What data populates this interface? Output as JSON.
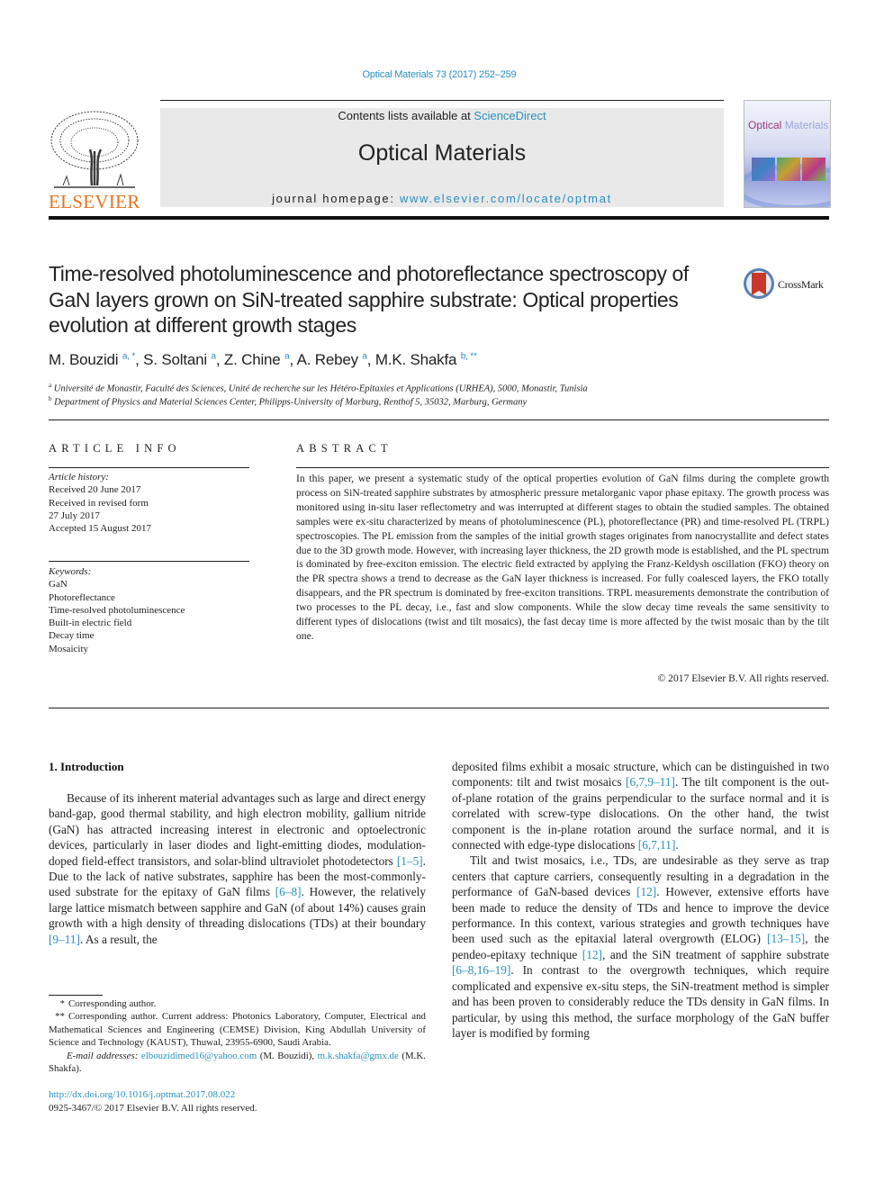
{
  "header": {
    "citation": "Optical Materials 73 (2017) 252–259",
    "publisher_wordmark": "ELSEVIER",
    "contents_prefix": "Contents lists available at ",
    "contents_link": "ScienceDirect",
    "journal_title": "Optical Materials",
    "homepage_prefix": "journal homepage: ",
    "homepage_link": "www.elsevier.com/locate/optmat",
    "cover": {
      "title_part1": "Optical ",
      "title_part2": "Materials"
    }
  },
  "article": {
    "title": "Time-resolved photoluminescence and photoreflectance spectroscopy of GaN layers grown on SiN-treated sapphire substrate: Optical properties evolution at different growth stages",
    "crossmark_label": "CrossMark",
    "authors": [
      {
        "name": "M. Bouzidi",
        "sup": "a, *",
        "sep": ", "
      },
      {
        "name": "S. Soltani",
        "sup": "a",
        "sep": ", "
      },
      {
        "name": "Z. Chine",
        "sup": "a",
        "sep": ", "
      },
      {
        "name": "A. Rebey",
        "sup": "a",
        "sep": ", "
      },
      {
        "name": "M.K. Shakfa",
        "sup": "b, **",
        "sep": ""
      }
    ],
    "affiliations": [
      {
        "mark": "a",
        "text": "Université de Monastir, Faculté des Sciences, Unité de recherche sur les Hétéro-Epitaxies et Applications (URHEA), 5000, Monastir, Tunisia"
      },
      {
        "mark": "b",
        "text": "Department of Physics and Material Sciences Center, Philipps-University of Marburg, Renthof 5, 35032, Marburg, Germany"
      }
    ]
  },
  "article_info": {
    "heading": "ARTICLE INFO",
    "history_label": "Article history:",
    "history": [
      "Received 20 June 2017",
      "Received in revised form",
      "27 July 2017",
      "Accepted 15 August 2017"
    ],
    "keywords_label": "Keywords:",
    "keywords": [
      "GaN",
      "Photoreflectance",
      "Time-resolved photoluminescence",
      "Built-in electric field",
      "Decay time",
      "Mosaicity"
    ]
  },
  "abstract": {
    "heading": "ABSTRACT",
    "text": "In this paper, we present a systematic study of the optical properties evolution of GaN films during the complete growth process on SiN-treated sapphire substrates by atmospheric pressure metalorganic vapor phase epitaxy. The growth process was monitored using in-situ laser reflectometry and was interrupted at different stages to obtain the studied samples. The obtained samples were ex-situ characterized by means of photoluminescence (PL), photoreflectance (PR) and time-resolved PL (TRPL) spectroscopies. The PL emission from the samples of the initial growth stages originates from nanocrystallite and defect states due to the 3D growth mode. However, with increasing layer thickness, the 2D growth mode is established, and the PL spectrum is dominated by free-exciton emission. The electric field extracted by applying the Franz-Keldysh oscillation (FKO) theory on the PR spectra shows a trend to decrease as the GaN layer thickness is increased. For fully coalesced layers, the FKO totally disappears, and the PR spectrum is dominated by free-exciton transitions. TRPL measurements demonstrate the contribution of two processes to the PL decay, i.e., fast and slow components. While the slow decay time reveals the same sensitivity to different types of dislocations (twist and tilt mosaics), the fast decay time is more affected by the twist mosaic than by the tilt one.",
    "copyright": "© 2017 Elsevier B.V. All rights reserved."
  },
  "body": {
    "section_heading": "1.  Introduction",
    "left_paragraph": [
      {
        "t": "Because of its inherent material advantages such as large and direct energy band-gap, good thermal stability, and high electron mobility, gallium nitride (GaN) has attracted increasing interest in electronic and optoelectronic devices, particularly in laser diodes and light-emitting diodes, modulation-doped field-effect transistors, and solar-blind ultraviolet photodetectors "
      },
      {
        "ref": "[1–5]"
      },
      {
        "t": ". Due to the lack of native substrates, sapphire has been the most-commonly-used substrate for the epitaxy of GaN films "
      },
      {
        "ref": "[6–8]"
      },
      {
        "t": ". However, the relatively large lattice mismatch between sapphire and GaN (of about 14%) causes grain growth with a high density of threading dislocations (TDs) at their boundary "
      },
      {
        "ref": "[9–11]"
      },
      {
        "t": ". As a result, the"
      }
    ],
    "right_paragraph_1": [
      {
        "t": "deposited films exhibit a mosaic structure, which can be distinguished in two components: tilt and twist mosaics "
      },
      {
        "ref": "[6,7,9–11]"
      },
      {
        "t": ". The tilt component is the out-of-plane rotation of the grains perpendicular to the surface normal and it is correlated with screw-type dislocations. On the other hand, the twist component is the in-plane rotation around the surface normal, and it is connected with edge-type dislocations "
      },
      {
        "ref": "[6,7,11]"
      },
      {
        "t": "."
      }
    ],
    "right_paragraph_2": [
      {
        "t": "Tilt and twist mosaics, i.e., TDs, are undesirable as they serve as trap centers that capture carriers, consequently resulting in a degradation in the performance of GaN-based devices "
      },
      {
        "ref": "[12]"
      },
      {
        "t": ". However, extensive efforts have been made to reduce the density of TDs and hence to improve the device performance. In this context, various strategies and growth techniques have been used such as the epitaxial lateral overgrowth (ELOG) "
      },
      {
        "ref": "[13–15]"
      },
      {
        "t": ", the pendeo-epitaxy technique "
      },
      {
        "ref": "[12]"
      },
      {
        "t": ", and the SiN treatment of sapphire substrate "
      },
      {
        "ref": "[6–8,16–19]"
      },
      {
        "t": ". In contrast to the overgrowth techniques, which require complicated and expensive ex-situ steps, the SiN-treatment method is simpler and has been proven to considerably reduce the TDs density in GaN films. In particular, by using this method, the surface morphology of the GaN buffer layer is modified by forming"
      }
    ]
  },
  "footnotes": {
    "fn1_mark": "*",
    "fn1_text": "Corresponding author.",
    "fn2_mark": "**",
    "fn2_text": "Corresponding author. Current address: Photonics Laboratory, Computer, Electrical and Mathematical Sciences and Engineering (CEMSE) Division, King Abdullah University of Science and Technology (KAUST), Thuwal, 23955-6900, Saudi Arabia.",
    "email_label": "E-mail addresses:",
    "email1": "elbouzidimed16@yahoo.com",
    "email1_owner": " (M. Bouzidi), ",
    "email2": "m.k.shakfa@gmx.de",
    "email2_owner": " (M.K. Shakfa).",
    "doi": "http://dx.doi.org/10.1016/j.optmat.2017.08.022",
    "issn_line": "0925-3467/© 2017 Elsevier B.V. All rights reserved."
  }
}
